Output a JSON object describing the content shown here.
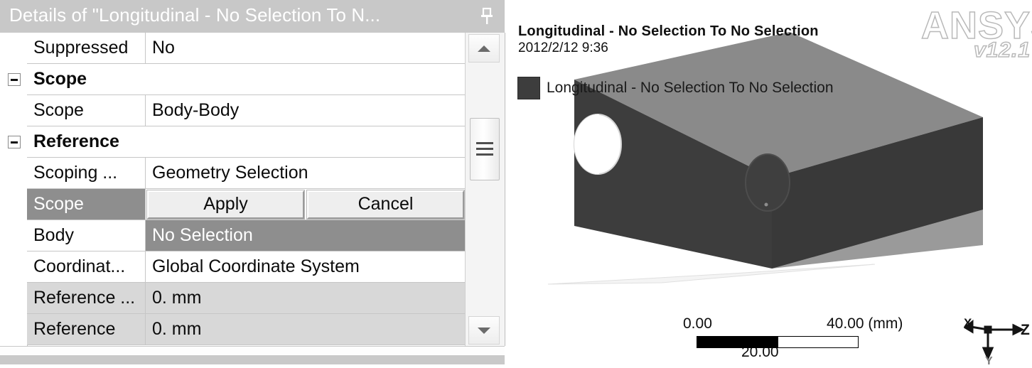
{
  "details_panel": {
    "title": "Details of \"Longitudinal - No Selection To N...",
    "pin_icon": "pushpin-icon",
    "rows": [
      {
        "label": "Suppressed",
        "value": "No",
        "type": "field",
        "state": "normal",
        "expander": null
      },
      {
        "label": "Scope",
        "value": "",
        "type": "group",
        "state": "normal",
        "expander": "minus"
      },
      {
        "label": "Scope",
        "value": "Body-Body",
        "type": "field",
        "state": "normal",
        "expander": null
      },
      {
        "label": "Reference",
        "value": "",
        "type": "group",
        "state": "normal",
        "expander": "minus"
      },
      {
        "label": "Scoping ...",
        "value": "Geometry Selection",
        "type": "field",
        "state": "normal",
        "expander": null
      },
      {
        "label": "Scope",
        "value": "",
        "type": "buttons",
        "state": "selected-label",
        "expander": null
      },
      {
        "label": "Body",
        "value": "No Selection",
        "type": "field",
        "state": "selected-value",
        "expander": null
      },
      {
        "label": "Coordinat...",
        "value": "Global Coordinate System",
        "type": "field",
        "state": "normal",
        "expander": null
      },
      {
        "label": "Reference ...",
        "value": "0. mm",
        "type": "field",
        "state": "readonly",
        "expander": null
      },
      {
        "label": "Reference",
        "value": "0. mm",
        "type": "field",
        "state": "readonly",
        "expander": null
      }
    ],
    "buttons": {
      "apply_label": "Apply",
      "cancel_label": "Cancel"
    },
    "scrollbar": {
      "up_icon": "scroll-up-arrow-icon",
      "down_icon": "scroll-down-arrow-icon",
      "thumb_icon": "scrollbar-thumb"
    }
  },
  "viewport": {
    "title": "Longitudinal - No Selection To No Selection",
    "date": "2012/2/12 9:36",
    "legend": {
      "label": "Longitudinal - No Selection To No Selection",
      "swatch_color": "#3d3d3d"
    },
    "logo": {
      "word": "ANSYS",
      "version": "v12.1"
    },
    "scale_bar": {
      "min": "0.00",
      "mid": "20.00",
      "max": "40.00 (mm)"
    },
    "axis_triad": {
      "x_label": "X",
      "y_label": "Y",
      "z_label": "Z"
    },
    "model": {
      "body_face_color": "#3d3d3d",
      "top_face_color": "#8a8a8a",
      "end_face_color": "#3a3a3a",
      "inner_bottom_color": "#9a9a9a"
    }
  }
}
